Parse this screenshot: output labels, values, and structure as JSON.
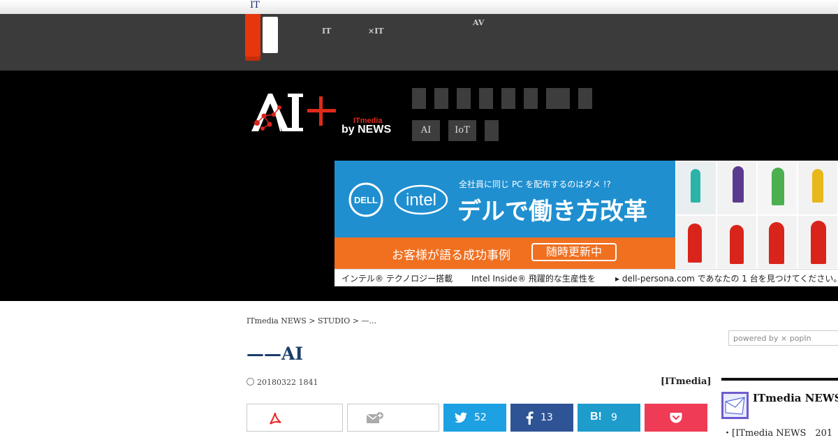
{
  "top_strip": {
    "label": "IT"
  },
  "global_nav": {
    "links": [
      {
        "label": "  \nIT"
      },
      {
        "label": "  \n×IT"
      },
      {
        "label": "AV\n  "
      }
    ]
  },
  "brand": {
    "logo_text": "AI+",
    "itmedia": "ITmedia",
    "by_news": "by NEWS"
  },
  "site_nav": {
    "row2": [
      {
        "label": "AI"
      },
      {
        "label": "IoT"
      }
    ]
  },
  "ad": {
    "dell": "DELL",
    "intel": "intel",
    "headline_small": "全社員に同じ PC を配布するのはダメ !?",
    "headline_large": "デルで働き方改革",
    "orange_text": "お客様が語る成功事例",
    "orange_button": "随時更新中",
    "bottom_left": "インテル® テクノロジー搭載",
    "bottom_mid": "Intel Inside® 飛躍的な生産性を",
    "bottom_right": "dell-persona.com であなたの 1 台を見つけてください。"
  },
  "breadcrumb": {
    "items": [
      "ITmedia NEWS",
      "STUDIO",
      "—..."
    ],
    "separator": ">"
  },
  "article": {
    "title": "——AI",
    "date": "20180322 1841",
    "byline": "[ITmedia]"
  },
  "share": {
    "twitter_count": "52",
    "facebook_count": "13",
    "hatena_label": "B!",
    "hatena_count": "9"
  },
  "sidebar": {
    "popin": "powered by ⨯ popIn",
    "title": "ITmedia NEWS",
    "items": [
      "・[ITmedia NEWS 201"
    ]
  },
  "colors": {
    "accent_red": "#e6360d",
    "twitter": "#1da1e2",
    "facebook": "#2f5495",
    "hatena": "#1e9ccc",
    "pocket": "#ef3b55",
    "ad_blue": "#1f8fd0",
    "ad_orange": "#f07020",
    "title_blue": "#1a3d6b"
  },
  "icons": [
    "adobe-pdf-icon",
    "mail-add-icon",
    "twitter-icon",
    "facebook-icon",
    "hatena-icon",
    "pocket-icon",
    "clock-icon",
    "newsletter-envelope-icon"
  ]
}
